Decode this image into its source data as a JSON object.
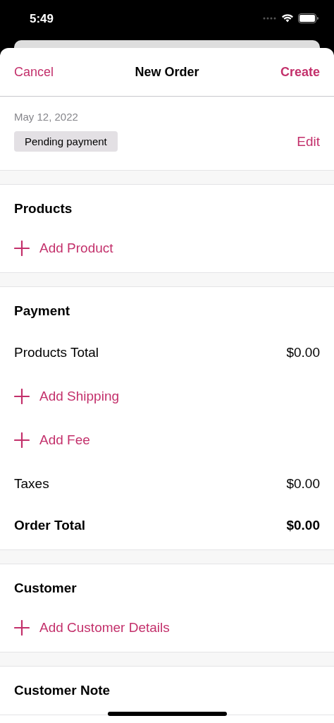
{
  "status_bar": {
    "time": "5:49"
  },
  "nav": {
    "cancel": "Cancel",
    "title": "New Order",
    "create": "Create"
  },
  "order_info": {
    "date": "May 12, 2022",
    "status": "Pending payment",
    "edit": "Edit"
  },
  "sections": [
    {
      "rows": [
        {
          "kind": "heading",
          "label": "Products"
        },
        {
          "kind": "add",
          "label": "Add Product"
        }
      ]
    },
    {
      "rows": [
        {
          "kind": "heading",
          "label": "Payment"
        },
        {
          "kind": "line",
          "label": "Products Total",
          "value": "$0.00"
        },
        {
          "kind": "add",
          "label": "Add Shipping"
        },
        {
          "kind": "add",
          "label": "Add Fee"
        },
        {
          "kind": "line",
          "label": "Taxes",
          "value": "$0.00"
        },
        {
          "kind": "total",
          "label": "Order Total",
          "value": "$0.00"
        }
      ]
    },
    {
      "rows": [
        {
          "kind": "heading",
          "label": "Customer"
        },
        {
          "kind": "add",
          "label": "Add Customer Details"
        }
      ]
    },
    {
      "rows": [
        {
          "kind": "heading",
          "label": "Customer Note"
        }
      ]
    }
  ]
}
